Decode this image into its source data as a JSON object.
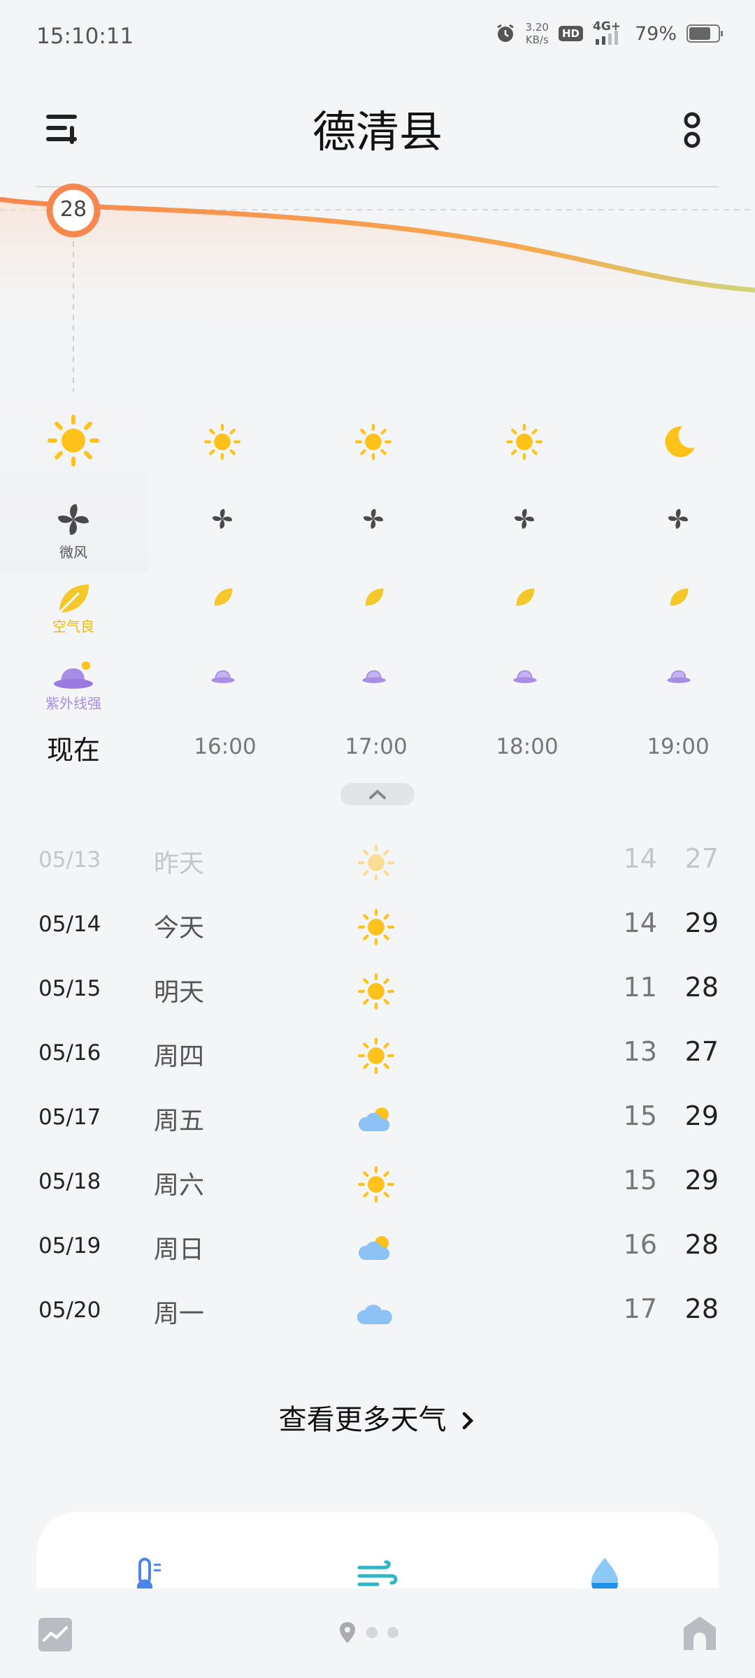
{
  "status_bar": {
    "time": "15:10:11",
    "net_speed_value": "3.20",
    "net_speed_unit": "KB/s",
    "hd": "HD",
    "network": "4G+",
    "battery": "79%",
    "battery_level": 0.79
  },
  "header": {
    "city": "德清县"
  },
  "current": {
    "temperature": "28"
  },
  "hourly": {
    "now_wind": "微风",
    "now_air": "空气良",
    "now_uv": "紫外线强",
    "items": [
      {
        "time": "现在",
        "icon": "sun-icon"
      },
      {
        "time": "16:00",
        "icon": "sun-icon"
      },
      {
        "time": "17:00",
        "icon": "sun-icon"
      },
      {
        "time": "18:00",
        "icon": "sun-icon"
      },
      {
        "time": "19:00",
        "icon": "moon-icon"
      }
    ]
  },
  "daily": [
    {
      "date": "05/13",
      "name": "昨天",
      "icon": "sun-icon",
      "low": "14",
      "high": "27"
    },
    {
      "date": "05/14",
      "name": "今天",
      "icon": "sun-icon",
      "low": "14",
      "high": "29"
    },
    {
      "date": "05/15",
      "name": "明天",
      "icon": "sun-icon",
      "low": "11",
      "high": "28"
    },
    {
      "date": "05/16",
      "name": "周四",
      "icon": "sun-icon",
      "low": "13",
      "high": "27"
    },
    {
      "date": "05/17",
      "name": "周五",
      "icon": "partly-cloudy-icon",
      "low": "15",
      "high": "29"
    },
    {
      "date": "05/18",
      "name": "周六",
      "icon": "sun-icon",
      "low": "15",
      "high": "29"
    },
    {
      "date": "05/19",
      "name": "周日",
      "icon": "partly-cloudy-icon",
      "low": "16",
      "high": "28"
    },
    {
      "date": "05/20",
      "name": "周一",
      "icon": "cloud-icon",
      "low": "17",
      "high": "28"
    }
  ],
  "more_weather": "查看更多天气",
  "colors": {
    "sun": "#ffc21a",
    "temp_line": "#f7874f",
    "uv": "#a98ce6",
    "air": "#f5c829",
    "cloud": "#8cc2f5"
  }
}
